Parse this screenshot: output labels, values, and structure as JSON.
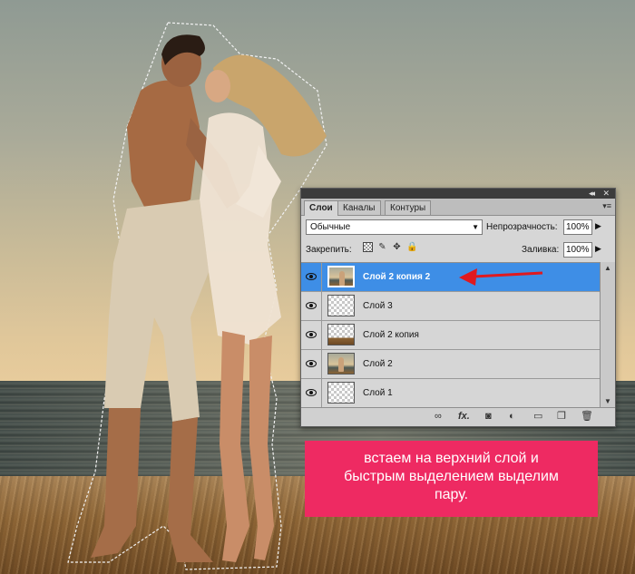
{
  "panel": {
    "tabs": [
      {
        "label": "Слои"
      },
      {
        "label": "Каналы"
      },
      {
        "label": "Контуры"
      }
    ],
    "blend_mode": "Обычные",
    "opacity_label": "Непрозрачность:",
    "opacity_value": "100%",
    "lock_label": "Закрепить:",
    "fill_label": "Заливка:",
    "fill_value": "100%",
    "layers": [
      {
        "name": "Слой 2 копия 2",
        "selected": true,
        "thumb": "photo"
      },
      {
        "name": "Слой 3",
        "selected": false,
        "thumb": "transparent"
      },
      {
        "name": "Слой 2 копия",
        "selected": false,
        "thumb": "partial"
      },
      {
        "name": "Слой 2",
        "selected": false,
        "thumb": "photo"
      },
      {
        "name": "Слой 1",
        "selected": false,
        "thumb": "transparent"
      }
    ],
    "bottom_icons": [
      "link-icon",
      "fx-icon",
      "mask-icon",
      "adjustment-icon",
      "folder-icon",
      "new-layer-icon",
      "trash-icon"
    ]
  },
  "annotation": {
    "lines": [
      "встаем на верхний слой и",
      "быстрым выделением выделим",
      "пару."
    ],
    "background_color": "#ee2a62",
    "arrow_color": "#e0191f"
  },
  "accent": {
    "selection_color": "#3e8ee6"
  }
}
